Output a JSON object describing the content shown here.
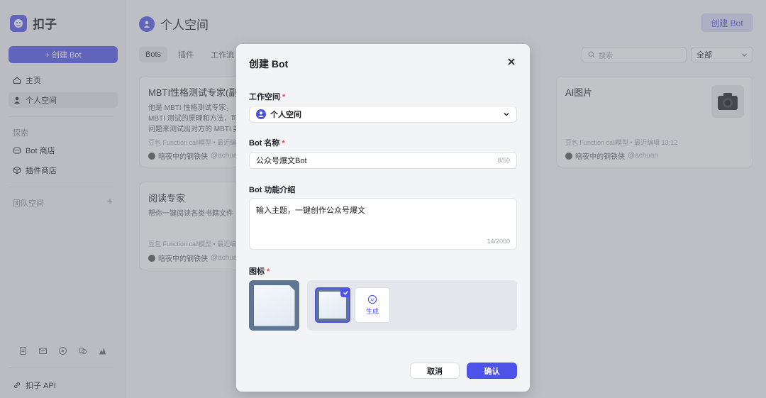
{
  "app": {
    "name": "扣子"
  },
  "sidebar": {
    "create_label": "+ 创建 Bot",
    "nav": [
      {
        "label": "主页",
        "icon": "home-icon"
      },
      {
        "label": "个人空间",
        "icon": "person-icon",
        "active": true
      }
    ],
    "explore_label": "探索",
    "explore_items": [
      {
        "label": "Bot 商店",
        "icon": "bot-icon"
      },
      {
        "label": "插件商店",
        "icon": "cube-icon"
      }
    ],
    "team_label": "团队空间",
    "team_plus": "+",
    "api_label": "扣子 API"
  },
  "header": {
    "title": "个人空间",
    "create_label": "创建 Bot"
  },
  "tabs": [
    {
      "label": "Bots",
      "active": true
    },
    {
      "label": "插件"
    },
    {
      "label": "工作流"
    }
  ],
  "search": {
    "placeholder": "搜索"
  },
  "filter": {
    "value": "全部"
  },
  "cards": [
    {
      "title": "MBTI性格测试专家(副本",
      "desc": "他是 MBTI 性格测试专家，\nMBTI 测试的原理和方法，可\n问题来测试出对方的 MBTI 类",
      "meta": "豆包 Function call模型 • 最近编",
      "author": "暗夜中的钢铁侠",
      "handle": "@achua"
    },
    {
      "title": "AI图片",
      "desc": "",
      "meta": "豆包 Function call模型 • 最近编辑 13:12",
      "author": "暗夜中的钢铁侠",
      "handle": "@achuan"
    },
    {
      "title": "阅读专家",
      "desc": "帮你一键阅读各类书籍文件",
      "meta": "豆包 Function call模型 • 最近编",
      "author": "暗夜中的钢铁侠",
      "handle": "@achua"
    }
  ],
  "modal": {
    "title": "创建 Bot",
    "workspace_label": "工作空间",
    "workspace_value": "个人空间",
    "name_label": "Bot 名称",
    "name_value": "公众号爆文Bot",
    "name_counter": "8/50",
    "desc_label": "Bot 功能介绍",
    "desc_value": "输入主题，一键创作公众号爆文",
    "desc_counter": "14/2000",
    "icon_label": "图标",
    "ai_label": "生成",
    "ai_badge": "AI",
    "cancel_label": "取消",
    "confirm_label": "确认",
    "required_mark": "*"
  },
  "colors": {
    "brand": "#4d53e8",
    "required": "#f0444a"
  }
}
